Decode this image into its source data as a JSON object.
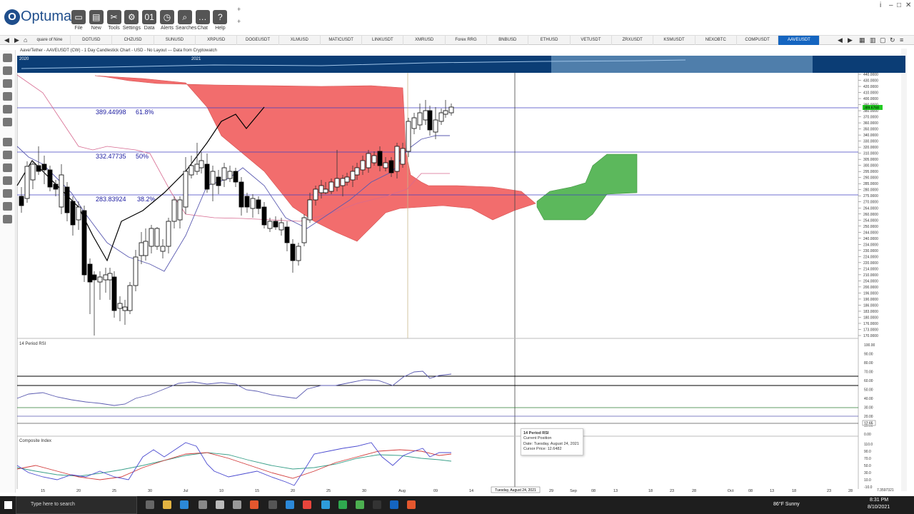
{
  "app": {
    "logo_text": "Optuma"
  },
  "toolbar": {
    "buttons": [
      {
        "label": "File",
        "icon": "folder-icon"
      },
      {
        "label": "New",
        "icon": "new-doc-icon"
      },
      {
        "label": "Tools",
        "icon": "tools-icon"
      },
      {
        "label": "Settings",
        "icon": "gear-icon"
      },
      {
        "label": "Data",
        "icon": "data-icon"
      },
      {
        "label": "Alerts",
        "icon": "alarm-clock-icon"
      },
      {
        "label": "Searches",
        "icon": "search-icon"
      },
      {
        "label": "Chat",
        "icon": "chat-icon"
      },
      {
        "label": "Help",
        "icon": "help-icon"
      }
    ]
  },
  "tabs": [
    "quare of Nine",
    "DOTUSD",
    "CHZUSD",
    "SUNUSD",
    "XRPUSD",
    "DOGEUSDT",
    "XLMUSD",
    "MATICUSDT",
    "LINKUSDT",
    "XMRUSD",
    "Forex RRG",
    "BNBUSD",
    "ETHUSD",
    "VETUSDT",
    "ZRXUSDT",
    "KSMUSDT",
    "NEXOBTC",
    "COMPUSDT",
    "AAVEUSDT"
  ],
  "chart_title": "Aave/Tether - AAVEUSDT (CW) - 1 Day Candlestick Chart - USD - No Layout --- Data from Cryptowatch",
  "timeline": {
    "labels": [
      "2020",
      "2021"
    ]
  },
  "fib": [
    {
      "price": "389.44998",
      "pct": "61.8%"
    },
    {
      "price": "332.47735",
      "pct": "50%"
    },
    {
      "price": "283.83924",
      "pct": "38.2%"
    }
  ],
  "price_axis": [
    "440.0000",
    "430.0000",
    "420.0000",
    "410.0000",
    "400.0000",
    "390.0000",
    "380.0000",
    "370.0000",
    "360.0000",
    "350.0000",
    "340.0000",
    "330.0000",
    "320.0000",
    "310.0000",
    "305.0000",
    "300.0000",
    "295.0000",
    "290.0000",
    "285.0000",
    "280.0000",
    "275.0000",
    "270.0000",
    "264.0000",
    "260.0000",
    "254.0000",
    "250.0000",
    "244.0000",
    "240.0000",
    "234.0000",
    "230.0000",
    "224.0000",
    "220.0000",
    "214.0000",
    "210.0000",
    "204.0000",
    "200.0000",
    "196.0000",
    "190.0000",
    "186.0000",
    "183.0000",
    "180.0000",
    "176.0000",
    "173.0000",
    "170.0000"
  ],
  "current_price": "389.6768",
  "rsi": {
    "label": "14 Period RSI",
    "axis": [
      "100.00",
      "90.00",
      "80.00",
      "70.00",
      "60.00",
      "50.00",
      "40.00",
      "30.00",
      "20.00",
      "10.00",
      "0.00"
    ],
    "cursor_value": "12.65"
  },
  "composite": {
    "label": "Composite Index",
    "axis": [
      "110.0",
      "90.0",
      "70.0",
      "50.0",
      "30.0",
      "10.0",
      "-10.0"
    ],
    "last_value": "7.3597321"
  },
  "date_axis": [
    "15",
    "20",
    "25",
    "30",
    "Jul",
    "10",
    "15",
    "20",
    "25",
    "30",
    "Aug",
    "09",
    "14",
    "29",
    "Sep",
    "08",
    "13",
    "18",
    "23",
    "28",
    "Oct",
    "08",
    "13",
    "18",
    "23",
    "28"
  ],
  "cursor_date_label": "Tuesday, August 24, 2021",
  "tooltip": {
    "title": "14 Period RSI",
    "line1": "Current Position",
    "line2": "Date: Tuesday, August 24, 2021",
    "line3": "Cursor Price: 12.6482"
  },
  "taskbar": {
    "search_placeholder": "Type here to search",
    "weather": "86°F  Sunny",
    "time": "8:31 PM",
    "date": "8/10/2021"
  },
  "colors": {
    "cloud_red": "#f26d6d",
    "cloud_green": "#5cb85c",
    "timeline_blue": "#0b3d75",
    "tab_active": "#1565c0",
    "fib_line": "#4040c0",
    "price_tag": "#22cc22"
  }
}
